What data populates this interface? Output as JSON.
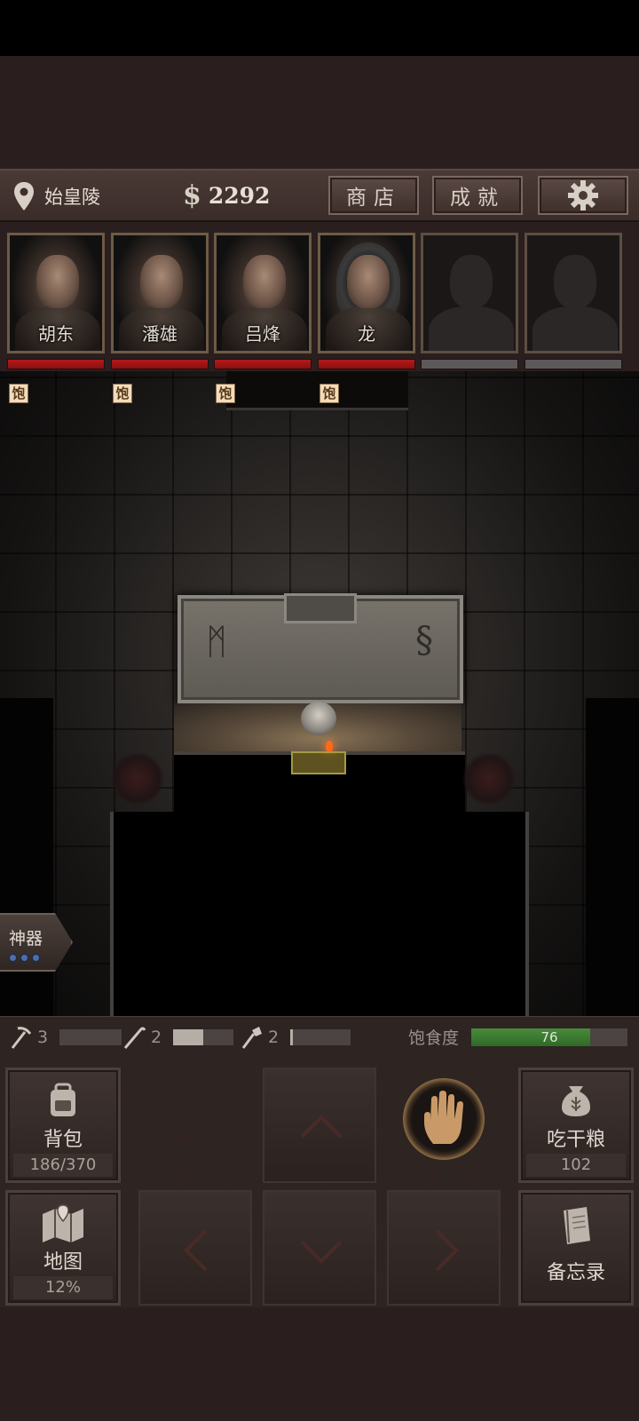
{
  "topbar": {
    "location": "始皇陵",
    "currency_symbol": "$",
    "money": "2292",
    "shop_label": "商店",
    "achievement_label": "成就",
    "settings_icon": "gear-icon",
    "location_icon": "map-pin-icon"
  },
  "party": [
    {
      "name": "胡东",
      "hp": 1.0,
      "status": "饱"
    },
    {
      "name": "潘雄",
      "hp": 1.0,
      "status": "饱"
    },
    {
      "name": "吕烽",
      "hp": 1.0,
      "status": "饱"
    },
    {
      "name": "龙",
      "hp": 1.0,
      "status": "饱"
    },
    {
      "name": "",
      "hp": 0,
      "status": ""
    },
    {
      "name": "",
      "hp": 0,
      "status": ""
    }
  ],
  "artifact": {
    "label": "神器",
    "charges": 3
  },
  "tools": [
    {
      "icon": "pickaxe-icon",
      "count": "3",
      "fill": 0.0
    },
    {
      "icon": "crowbar-icon",
      "count": "2",
      "fill": 0.5
    },
    {
      "icon": "shovel-icon",
      "count": "2",
      "fill": 0.05
    }
  ],
  "satiety": {
    "label": "饱食度",
    "value": "76",
    "fill": 0.76
  },
  "controls": {
    "backpack": {
      "label": "背包",
      "sub": "186/370"
    },
    "eat": {
      "label": "吃干粮",
      "sub": "102"
    },
    "map": {
      "label": "地图",
      "sub": "12%"
    },
    "memo": {
      "label": "备忘录"
    },
    "interact_icon": "hand-icon"
  },
  "colors": {
    "hp_red": "#b51a1a",
    "satiety_green": "#4a8a3c",
    "artifact_blue": "#4a6fb0"
  }
}
